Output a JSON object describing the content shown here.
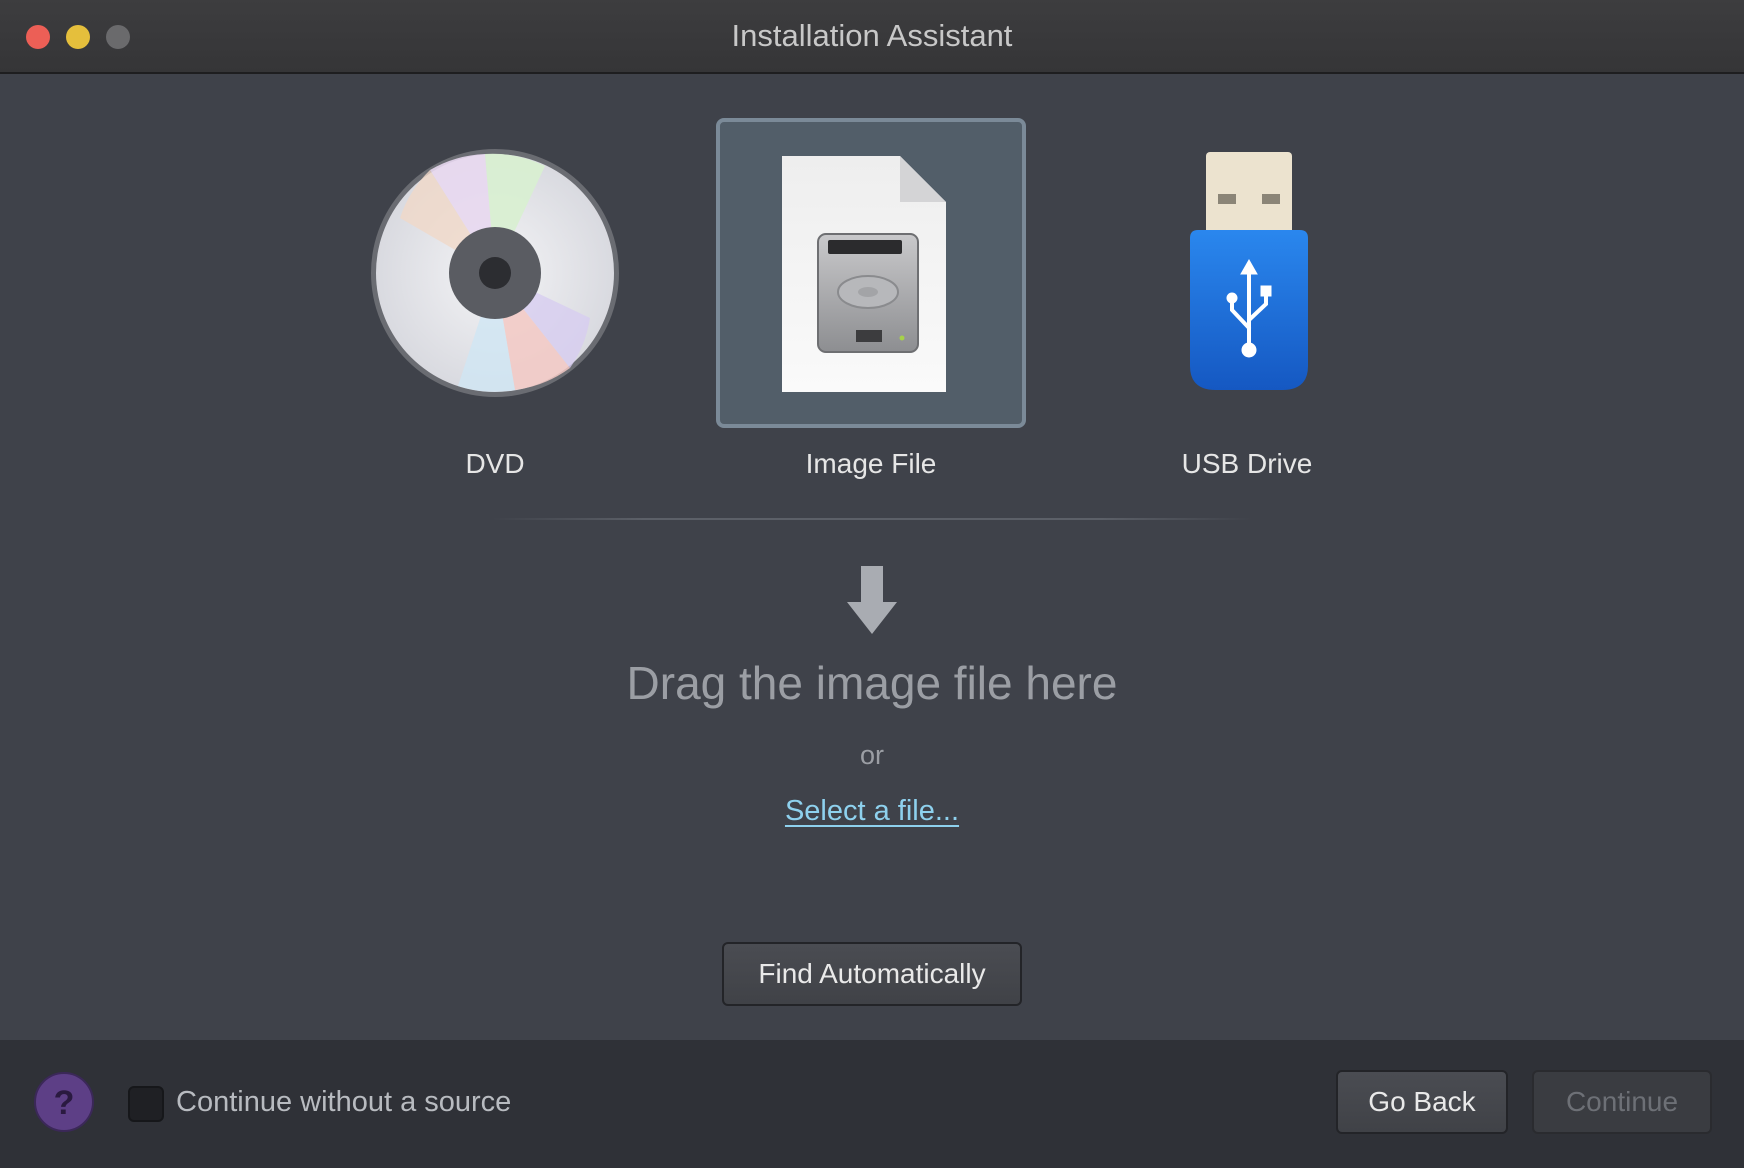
{
  "window": {
    "title": "Installation Assistant"
  },
  "sources": {
    "dvd": {
      "label": "DVD",
      "icon": "dvd-disc-icon"
    },
    "image": {
      "label": "Image File",
      "icon": "disk-image-file-icon",
      "selected": true
    },
    "usb": {
      "label": "USB Drive",
      "icon": "usb-drive-icon"
    }
  },
  "dropzone": {
    "icon": "down-arrow-icon",
    "title": "Drag the image file here",
    "or": "or",
    "select_link": "Select a file..."
  },
  "find_button": "Find Automatically",
  "footer": {
    "help_icon": "help-question-icon",
    "checkbox_label": "Continue without a source",
    "checkbox_checked": false,
    "back_button": "Go Back",
    "continue_button": "Continue",
    "continue_enabled": false
  },
  "colors": {
    "accent_link": "#8ed1ee",
    "close": "#ec5f56",
    "minimize": "#e5bf3c",
    "help": "#5d3f86",
    "usb_blue": "#1c74d9"
  }
}
